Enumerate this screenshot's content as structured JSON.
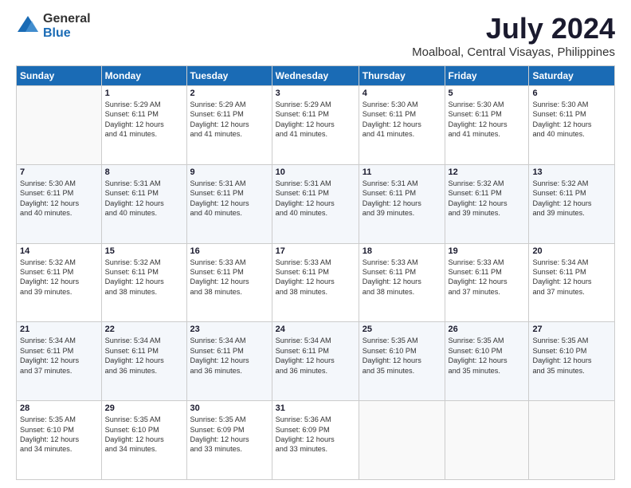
{
  "logo": {
    "general": "General",
    "blue": "Blue"
  },
  "title": "July 2024",
  "subtitle": "Moalboal, Central Visayas, Philippines",
  "weekdays": [
    "Sunday",
    "Monday",
    "Tuesday",
    "Wednesday",
    "Thursday",
    "Friday",
    "Saturday"
  ],
  "weeks": [
    [
      {
        "day": "",
        "info": ""
      },
      {
        "day": "1",
        "info": "Sunrise: 5:29 AM\nSunset: 6:11 PM\nDaylight: 12 hours\nand 41 minutes."
      },
      {
        "day": "2",
        "info": "Sunrise: 5:29 AM\nSunset: 6:11 PM\nDaylight: 12 hours\nand 41 minutes."
      },
      {
        "day": "3",
        "info": "Sunrise: 5:29 AM\nSunset: 6:11 PM\nDaylight: 12 hours\nand 41 minutes."
      },
      {
        "day": "4",
        "info": "Sunrise: 5:30 AM\nSunset: 6:11 PM\nDaylight: 12 hours\nand 41 minutes."
      },
      {
        "day": "5",
        "info": "Sunrise: 5:30 AM\nSunset: 6:11 PM\nDaylight: 12 hours\nand 41 minutes."
      },
      {
        "day": "6",
        "info": "Sunrise: 5:30 AM\nSunset: 6:11 PM\nDaylight: 12 hours\nand 40 minutes."
      }
    ],
    [
      {
        "day": "7",
        "info": "Sunrise: 5:30 AM\nSunset: 6:11 PM\nDaylight: 12 hours\nand 40 minutes."
      },
      {
        "day": "8",
        "info": "Sunrise: 5:31 AM\nSunset: 6:11 PM\nDaylight: 12 hours\nand 40 minutes."
      },
      {
        "day": "9",
        "info": "Sunrise: 5:31 AM\nSunset: 6:11 PM\nDaylight: 12 hours\nand 40 minutes."
      },
      {
        "day": "10",
        "info": "Sunrise: 5:31 AM\nSunset: 6:11 PM\nDaylight: 12 hours\nand 40 minutes."
      },
      {
        "day": "11",
        "info": "Sunrise: 5:31 AM\nSunset: 6:11 PM\nDaylight: 12 hours\nand 39 minutes."
      },
      {
        "day": "12",
        "info": "Sunrise: 5:32 AM\nSunset: 6:11 PM\nDaylight: 12 hours\nand 39 minutes."
      },
      {
        "day": "13",
        "info": "Sunrise: 5:32 AM\nSunset: 6:11 PM\nDaylight: 12 hours\nand 39 minutes."
      }
    ],
    [
      {
        "day": "14",
        "info": "Sunrise: 5:32 AM\nSunset: 6:11 PM\nDaylight: 12 hours\nand 39 minutes."
      },
      {
        "day": "15",
        "info": "Sunrise: 5:32 AM\nSunset: 6:11 PM\nDaylight: 12 hours\nand 38 minutes."
      },
      {
        "day": "16",
        "info": "Sunrise: 5:33 AM\nSunset: 6:11 PM\nDaylight: 12 hours\nand 38 minutes."
      },
      {
        "day": "17",
        "info": "Sunrise: 5:33 AM\nSunset: 6:11 PM\nDaylight: 12 hours\nand 38 minutes."
      },
      {
        "day": "18",
        "info": "Sunrise: 5:33 AM\nSunset: 6:11 PM\nDaylight: 12 hours\nand 38 minutes."
      },
      {
        "day": "19",
        "info": "Sunrise: 5:33 AM\nSunset: 6:11 PM\nDaylight: 12 hours\nand 37 minutes."
      },
      {
        "day": "20",
        "info": "Sunrise: 5:34 AM\nSunset: 6:11 PM\nDaylight: 12 hours\nand 37 minutes."
      }
    ],
    [
      {
        "day": "21",
        "info": "Sunrise: 5:34 AM\nSunset: 6:11 PM\nDaylight: 12 hours\nand 37 minutes."
      },
      {
        "day": "22",
        "info": "Sunrise: 5:34 AM\nSunset: 6:11 PM\nDaylight: 12 hours\nand 36 minutes."
      },
      {
        "day": "23",
        "info": "Sunrise: 5:34 AM\nSunset: 6:11 PM\nDaylight: 12 hours\nand 36 minutes."
      },
      {
        "day": "24",
        "info": "Sunrise: 5:34 AM\nSunset: 6:11 PM\nDaylight: 12 hours\nand 36 minutes."
      },
      {
        "day": "25",
        "info": "Sunrise: 5:35 AM\nSunset: 6:10 PM\nDaylight: 12 hours\nand 35 minutes."
      },
      {
        "day": "26",
        "info": "Sunrise: 5:35 AM\nSunset: 6:10 PM\nDaylight: 12 hours\nand 35 minutes."
      },
      {
        "day": "27",
        "info": "Sunrise: 5:35 AM\nSunset: 6:10 PM\nDaylight: 12 hours\nand 35 minutes."
      }
    ],
    [
      {
        "day": "28",
        "info": "Sunrise: 5:35 AM\nSunset: 6:10 PM\nDaylight: 12 hours\nand 34 minutes."
      },
      {
        "day": "29",
        "info": "Sunrise: 5:35 AM\nSunset: 6:10 PM\nDaylight: 12 hours\nand 34 minutes."
      },
      {
        "day": "30",
        "info": "Sunrise: 5:35 AM\nSunset: 6:09 PM\nDaylight: 12 hours\nand 33 minutes."
      },
      {
        "day": "31",
        "info": "Sunrise: 5:36 AM\nSunset: 6:09 PM\nDaylight: 12 hours\nand 33 minutes."
      },
      {
        "day": "",
        "info": ""
      },
      {
        "day": "",
        "info": ""
      },
      {
        "day": "",
        "info": ""
      }
    ]
  ]
}
